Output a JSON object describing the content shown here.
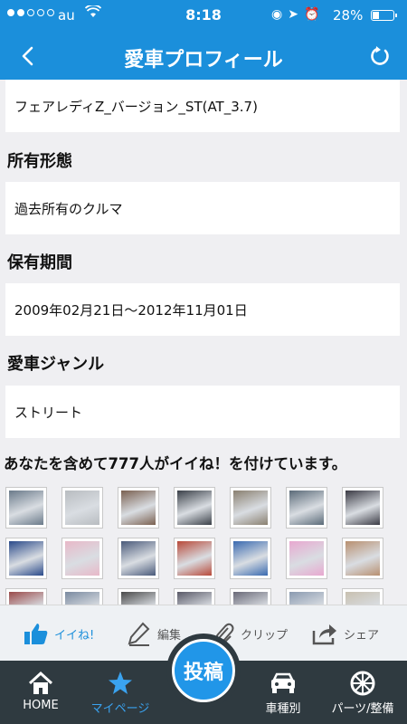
{
  "status_bar": {
    "carrier": "au",
    "time": "8:18",
    "battery": "28%"
  },
  "nav": {
    "title": "愛車プロフィール"
  },
  "profile": {
    "grade_value": "フェアレディZ_バージョン_ST(AT_3.7)",
    "ownership_label": "所有形態",
    "ownership_value": "過去所有のクルマ",
    "period_label": "保有期間",
    "period_value": "2009年02月21日〜2012年11月01日",
    "genre_label": "愛車ジャンル",
    "genre_value": "ストリート",
    "likes_text": "あなたを含めて777人がイイね！を付けています。"
  },
  "thumb_colors": [
    [
      "#6a7a8a",
      "#b8bcc0",
      "#7a6050",
      "#3a4048",
      "#8a8070",
      "#5a6a78",
      "#3a3a44"
    ],
    [
      "#2a4a8a",
      "#e8b8c8",
      "#4a5a7a",
      "#b84a3a",
      "#3a6ab0",
      "#e8a8d0",
      "#b89070"
    ],
    [
      "#9a4a4a",
      "#7a8aa0",
      "#4a4a4a",
      "#5a5a68",
      "#6a6a78",
      "#8a9ab0",
      "#c8c0b0"
    ]
  ],
  "actions": {
    "like": "イイね!",
    "edit": "編集",
    "clip": "クリップ",
    "share": "シェア"
  },
  "tabs": {
    "home": "HOME",
    "mypage": "マイページ",
    "post": "投稿",
    "cars": "車種別",
    "parts": "パーツ/整備"
  },
  "colors": {
    "brand": "#1b8fdb",
    "tabbar": "#2f3a40",
    "active_tab": "#3aa3f0"
  }
}
